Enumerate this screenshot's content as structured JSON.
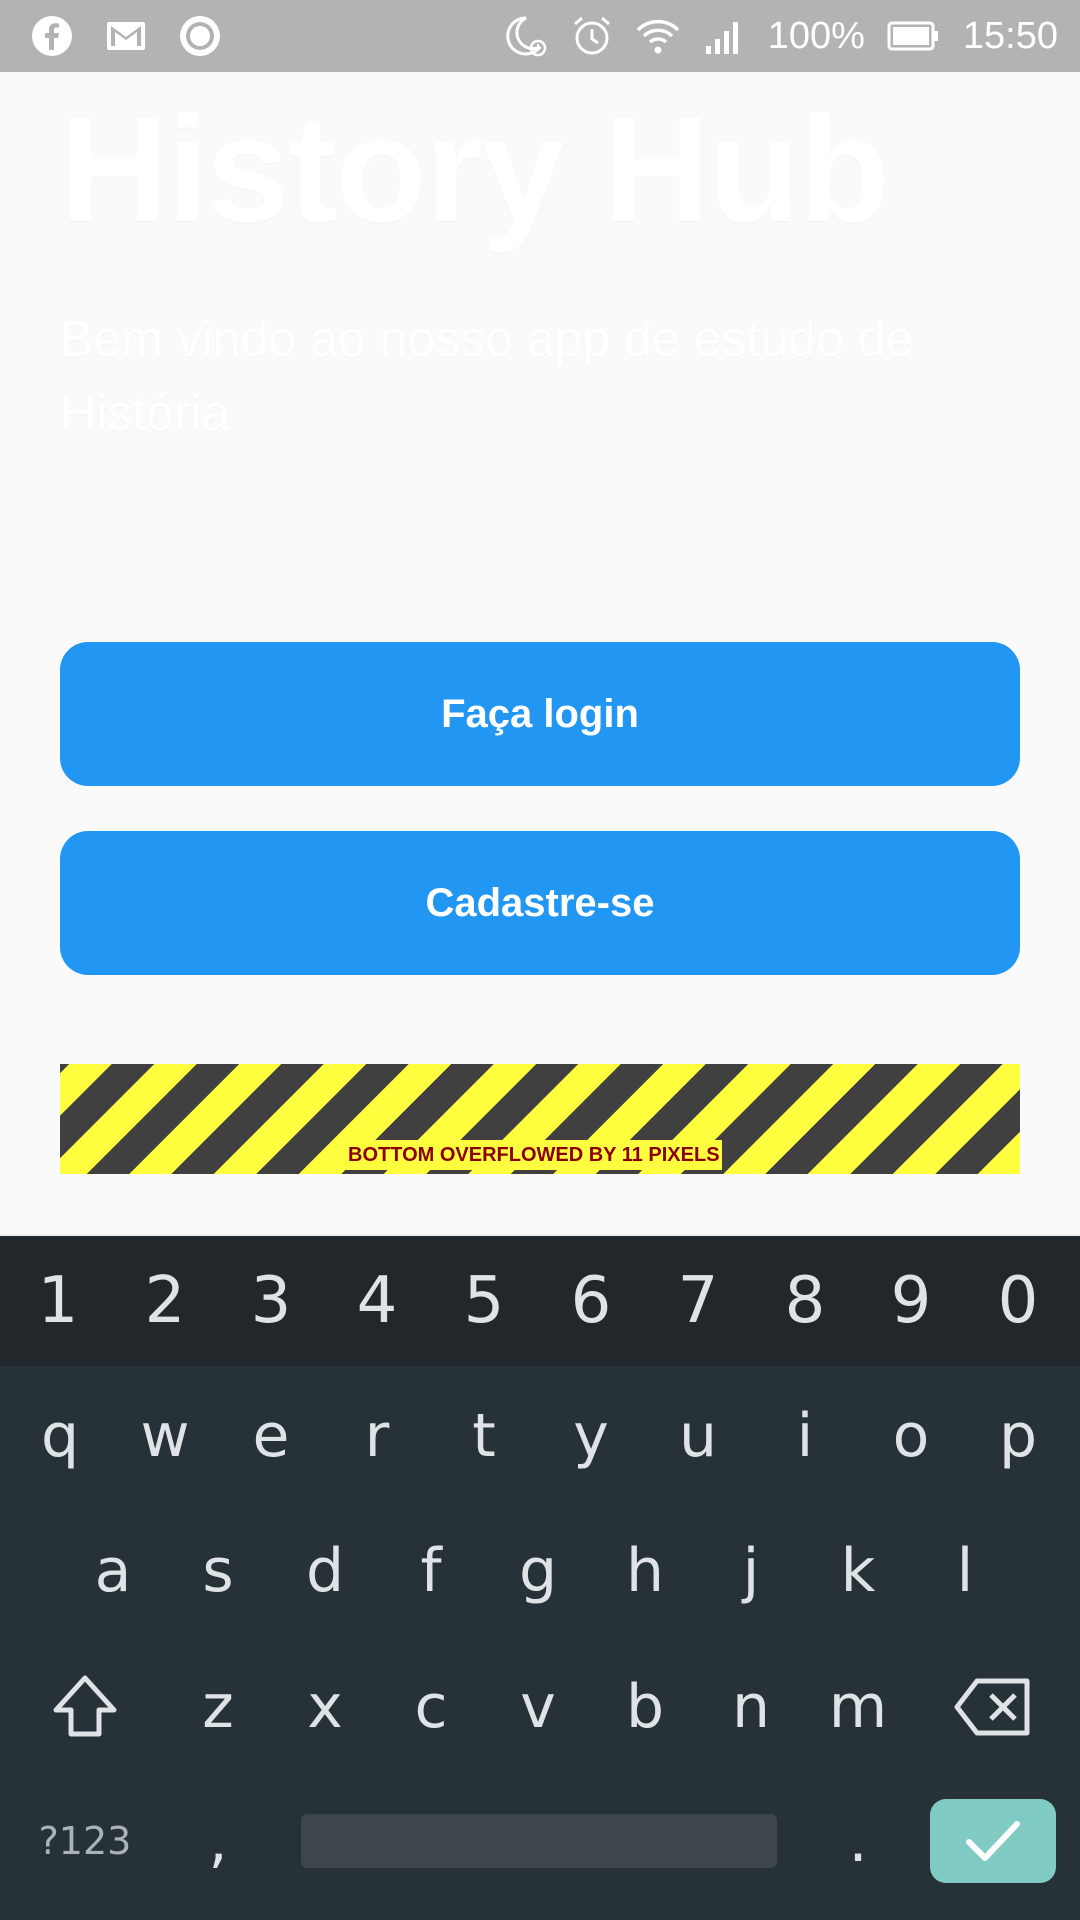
{
  "status_bar": {
    "left_icons": [
      "facebook-icon",
      "gmail-icon",
      "record-icon"
    ],
    "right_icons": [
      "do-not-disturb-alarm-icon",
      "alarm-icon",
      "wifi-icon",
      "signal-icon",
      "battery-icon"
    ],
    "battery": "100%",
    "time": "15:50"
  },
  "app": {
    "title": "History Hub",
    "subtitle": "Bem vindo ao nosso app de estudo de História",
    "login_label": "Faça login",
    "signup_label": "Cadastre-se",
    "overflow_warning": "BOTTOM OVERFLOWED BY 11 PIXELS",
    "colors": {
      "button": "#2196f3",
      "background": "#fafafa"
    }
  },
  "keyboard": {
    "number_row": [
      "1",
      "2",
      "3",
      "4",
      "5",
      "6",
      "7",
      "8",
      "9",
      "0"
    ],
    "row1": [
      "q",
      "w",
      "e",
      "r",
      "t",
      "y",
      "u",
      "i",
      "o",
      "p"
    ],
    "row2": [
      "a",
      "s",
      "d",
      "f",
      "g",
      "h",
      "j",
      "k",
      "l"
    ],
    "row3": [
      "z",
      "x",
      "c",
      "v",
      "b",
      "n",
      "m"
    ],
    "symbols_label": "?123",
    "comma": ",",
    "period": ".",
    "enter_color": "#80cbc4"
  }
}
